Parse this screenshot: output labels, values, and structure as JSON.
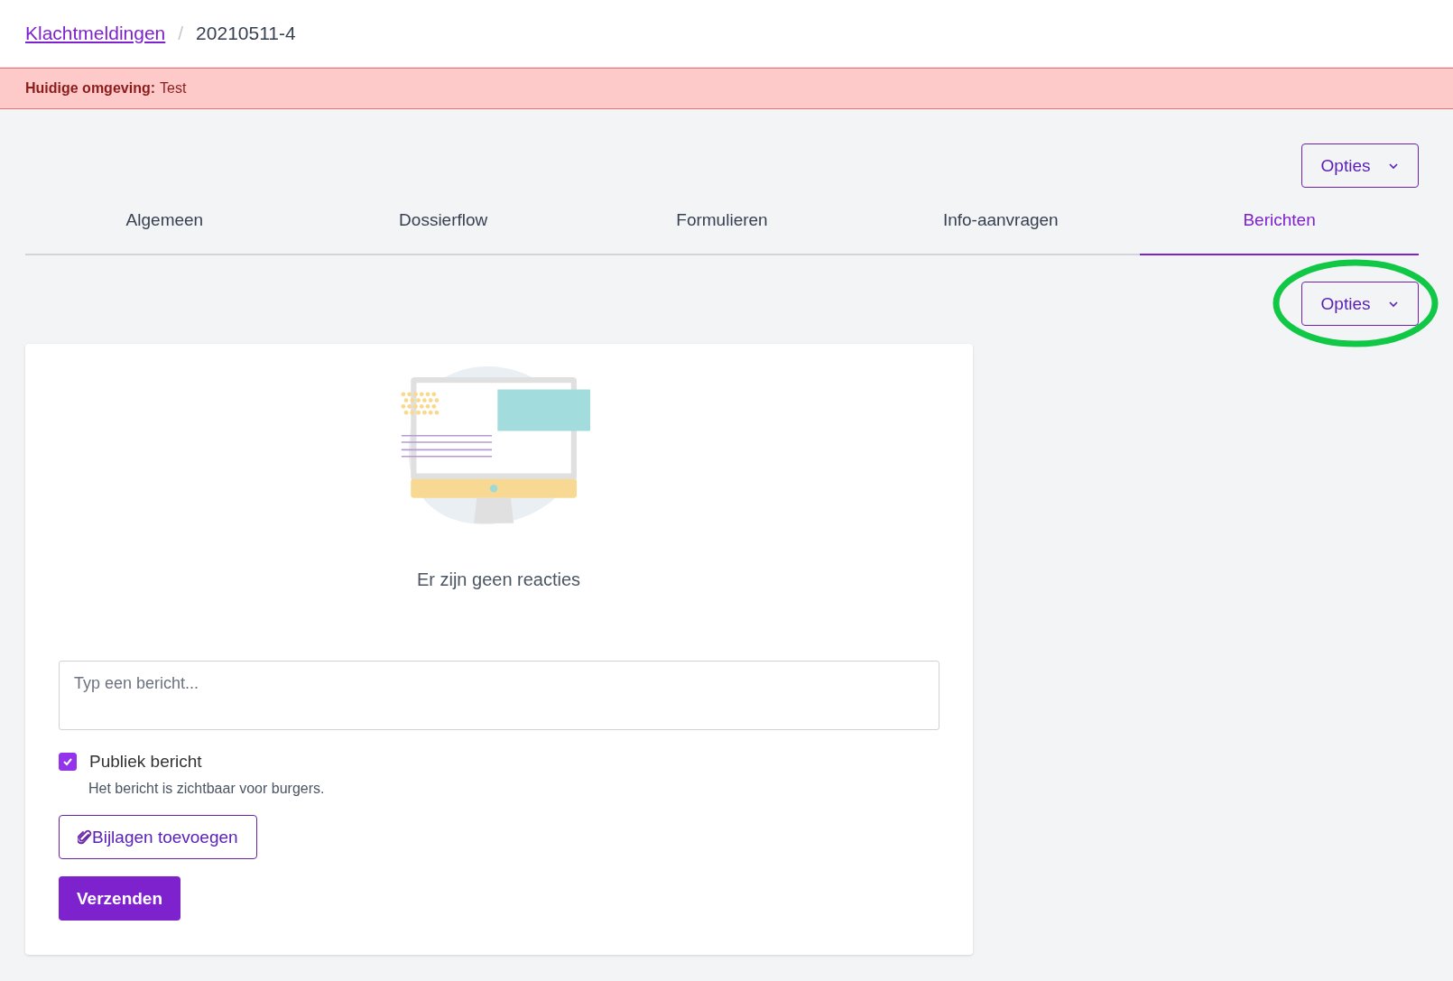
{
  "breadcrumb": {
    "link": "Klachtmeldingen",
    "separator": "/",
    "current": "20210511-4"
  },
  "environment_banner": {
    "label": "Huidige omgeving:",
    "value": "Test"
  },
  "page_options_button": {
    "label": "Opties"
  },
  "tabs": [
    {
      "label": "Algemeen",
      "selected": false
    },
    {
      "label": "Dossierflow",
      "selected": false
    },
    {
      "label": "Formulieren",
      "selected": false
    },
    {
      "label": "Info-aanvragen",
      "selected": false
    },
    {
      "label": "Berichten",
      "selected": true
    }
  ],
  "tab_options_button": {
    "label": "Opties",
    "highlighted": true
  },
  "messages": {
    "empty_text": "Er zijn geen reacties",
    "message_field": {
      "placeholder": "Typ een bericht..."
    },
    "public_checkbox": {
      "label": "Publiek bericht",
      "checked": true,
      "hint": "Het bericht is zichtbaar voor burgers."
    },
    "attach_button": "Bijlagen toevoegen",
    "send_button": "Verzenden"
  }
}
